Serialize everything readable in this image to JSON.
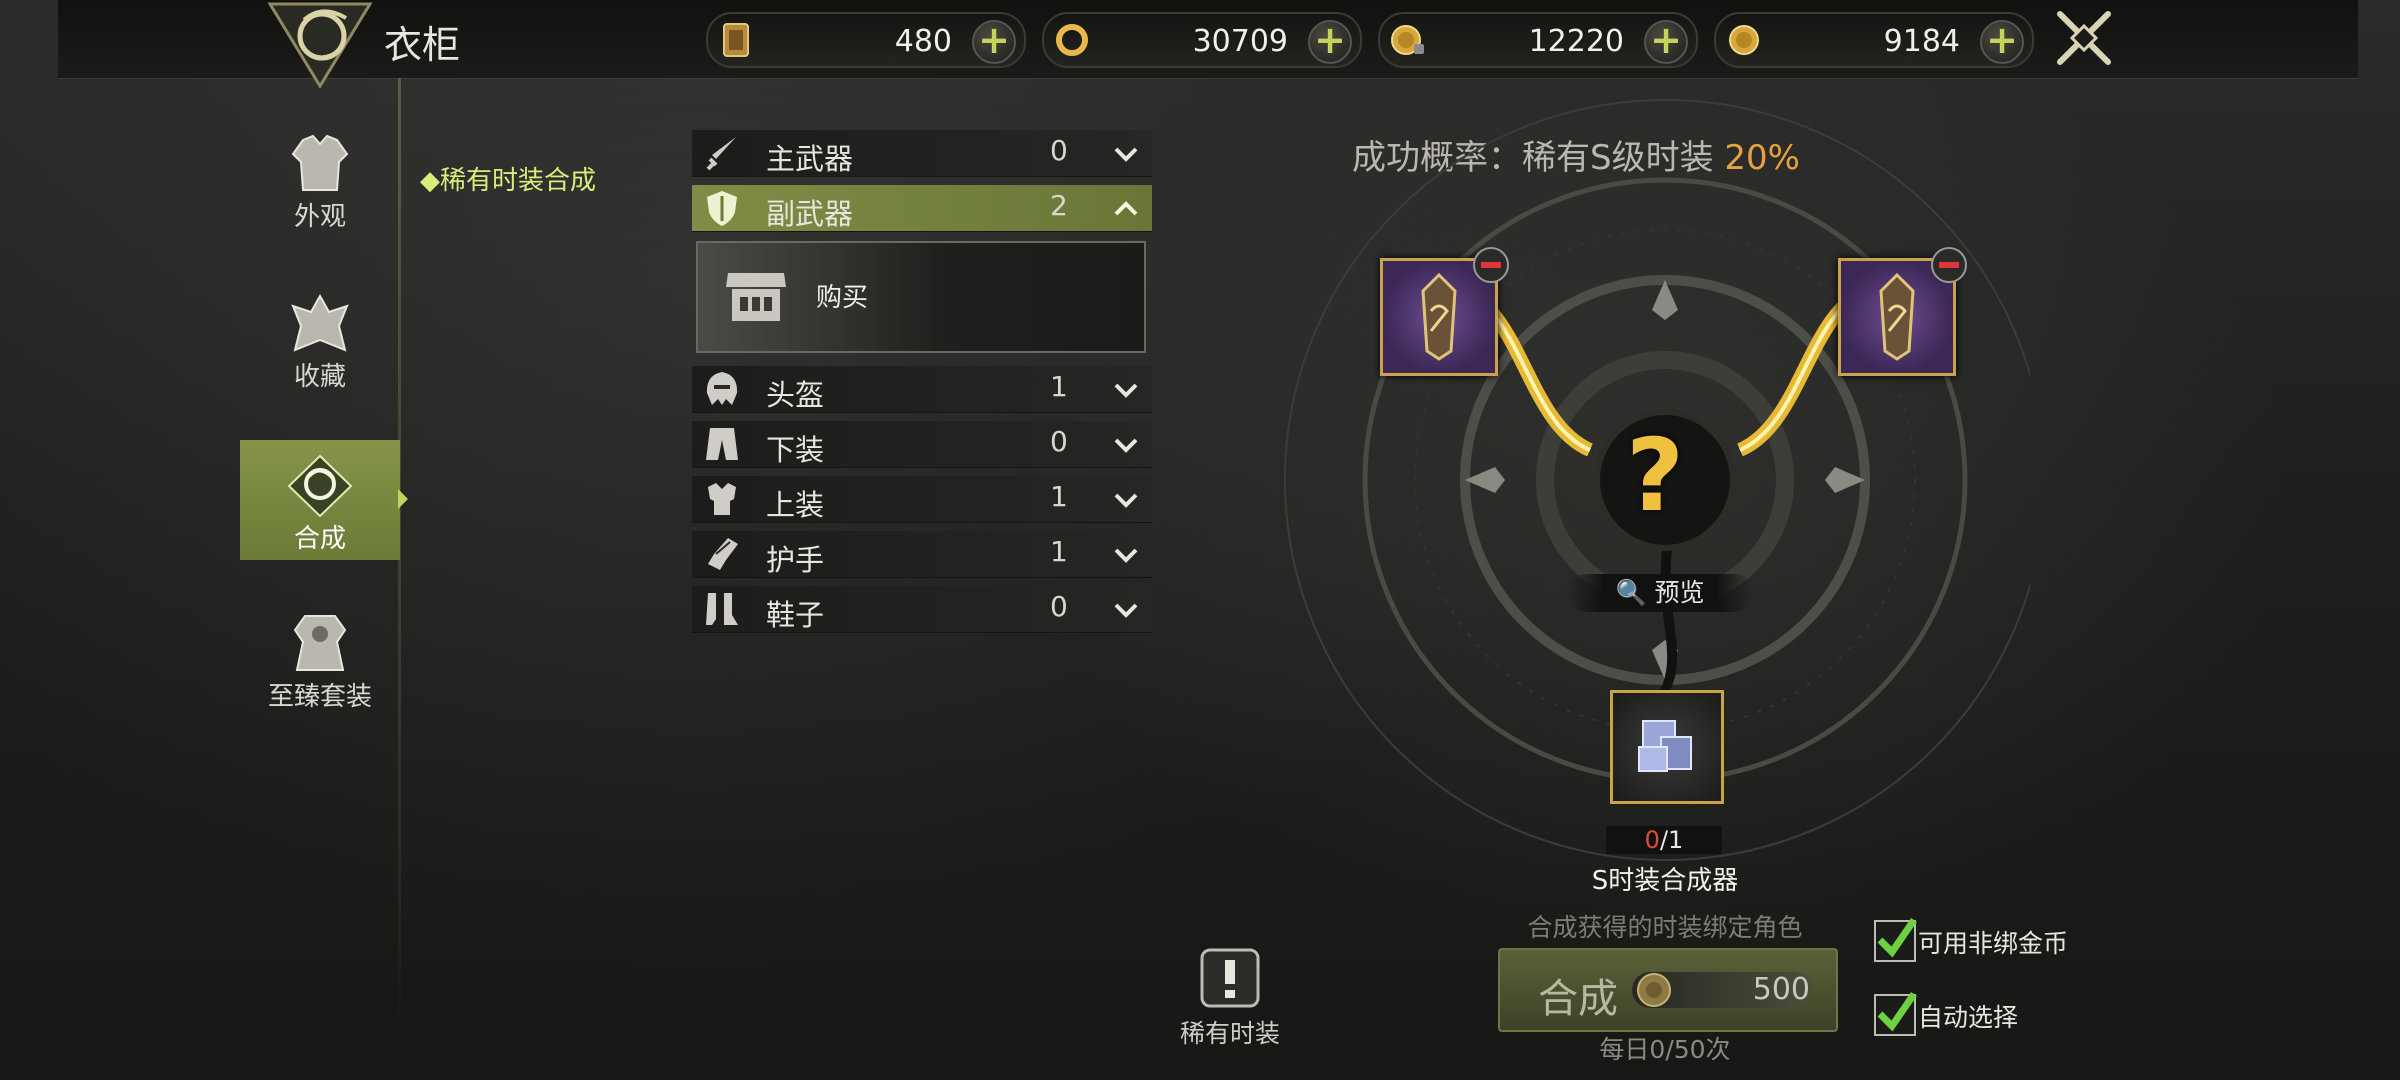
{
  "header": {
    "title": "衣柜",
    "currencies": [
      {
        "icon": "card-ticket-icon",
        "value": "480"
      },
      {
        "icon": "ring-token-icon",
        "value": "30709"
      },
      {
        "icon": "bound-gold-coin-icon",
        "value": "12220"
      },
      {
        "icon": "gold-coin-icon",
        "value": "9184"
      }
    ]
  },
  "nav": {
    "items": [
      {
        "label": "外观",
        "icon": "armor-appearance-icon"
      },
      {
        "label": "收藏",
        "icon": "collection-icon"
      },
      {
        "label": "合成",
        "icon": "synthesis-icon",
        "active": true
      },
      {
        "label": "至臻套装",
        "icon": "ultimate-set-icon"
      }
    ],
    "subtab": "◆稀有时装合成"
  },
  "categories": [
    {
      "label": "主武器",
      "count": "0",
      "icon": "dagger-icon",
      "expanded": false
    },
    {
      "label": "副武器",
      "count": "2",
      "icon": "shield-icon",
      "expanded": true
    },
    {
      "label": "头盔",
      "count": "1",
      "icon": "helmet-icon",
      "expanded": false
    },
    {
      "label": "下装",
      "count": "0",
      "icon": "pants-icon",
      "expanded": false
    },
    {
      "label": "上装",
      "count": "1",
      "icon": "chest-armor-icon",
      "expanded": false
    },
    {
      "label": "护手",
      "count": "1",
      "icon": "gauntlet-icon",
      "expanded": false
    },
    {
      "label": "鞋子",
      "count": "0",
      "icon": "boots-icon",
      "expanded": false
    }
  ],
  "buy": {
    "label": "购买",
    "icon": "shop-icon"
  },
  "synthesis": {
    "rate_label": "成功概率：稀有S级时装",
    "rate_value": "20%",
    "preview_label": "预览",
    "result_symbol": "?",
    "material_count_have": "0",
    "material_count_total": "/1",
    "material_name": "S时装合成器",
    "bind_note": "合成获得的时装绑定角色",
    "button_label": "合成",
    "cost": "500",
    "daily": "每日0/50次"
  },
  "rare": {
    "label": "稀有时装",
    "icon": "exclamation-icon"
  },
  "options": [
    {
      "label": "可用非绑金币",
      "checked": true
    },
    {
      "label": "自动选择",
      "checked": true
    }
  ],
  "colors": {
    "accent": "#c6d35b",
    "active_green": "#7f8d46",
    "gold": "#c9a24a",
    "rate": "#e7a13f",
    "purple_slot": "#5b3f7d"
  }
}
